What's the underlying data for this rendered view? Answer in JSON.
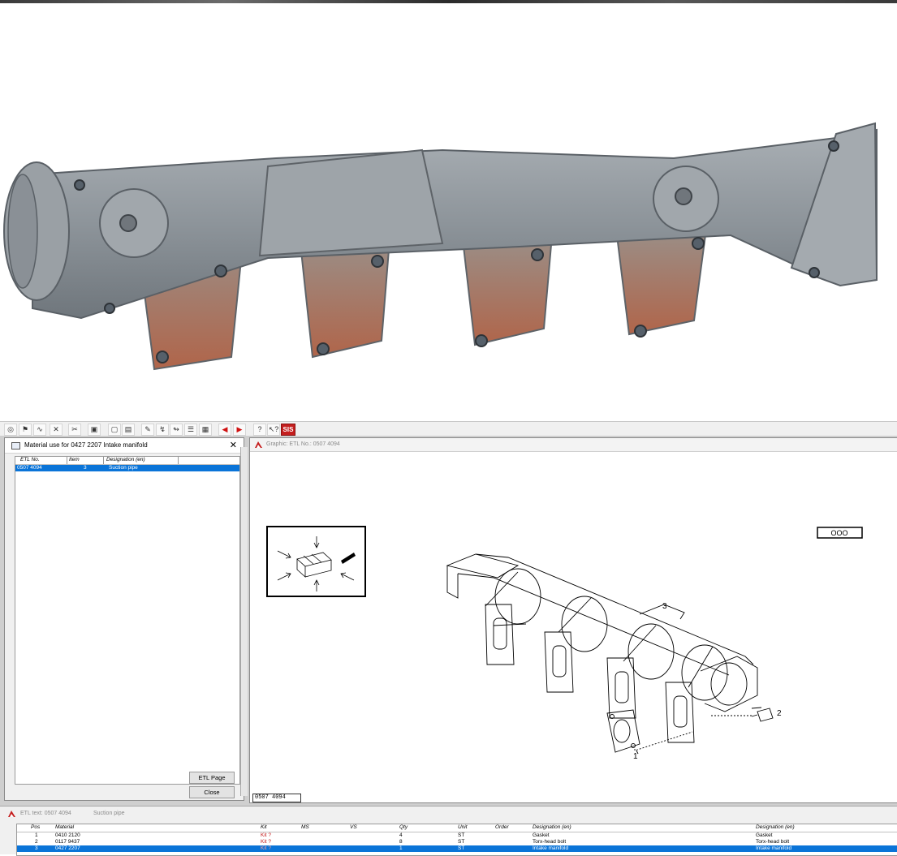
{
  "photo": {
    "subject_icon": "intake-manifold-photo"
  },
  "toolbar": {
    "buttons": [
      "glasses-icon",
      "bookmark-icon",
      "wrench-icon",
      "x-icon",
      "cut-icon",
      "print-icon",
      "new-doc-icon",
      "open-folder-icon",
      "pencil-icon",
      "ref-a-icon",
      "ref-b-icon",
      "list-icon",
      "grid-icon",
      "arrow-left-icon",
      "arrow-right-icon",
      "help-icon",
      "pointer-help-icon",
      "sis-logo"
    ],
    "sis_label": "SIS"
  },
  "material_dialog": {
    "title": "Material use for 0427 2207 Intake manifold",
    "close_symbol": "✕",
    "columns": [
      "ETL No.",
      "Item",
      "Designation (en)"
    ],
    "rows": [
      {
        "etl_no": "0507 4094",
        "item": "3",
        "designation": "Suction pipe"
      }
    ],
    "etl_page_button": "ETL Page",
    "close_button": "Close"
  },
  "graphic_window": {
    "title": "Graphic: ETL No.: 0507 4094",
    "etl_no_label": "0507 4094",
    "box_label": "OOO",
    "callouts": [
      "3",
      "2",
      "1"
    ]
  },
  "etl_text": {
    "title": "ETL text: 0507 4094",
    "description": "Suction pipe",
    "columns": [
      "Pos",
      "Material",
      "Kit",
      "MS",
      "VS",
      "Qty",
      "Unit",
      "Order",
      "Designation (en)",
      "Designation (en)"
    ],
    "rows": [
      {
        "pos": "1",
        "material": "0410 2120",
        "kit": "Kit ?",
        "qty": "4",
        "unit": "ST",
        "designation": "Gasket",
        "designation2": "Gasket",
        "selected": false
      },
      {
        "pos": "2",
        "material": "0117 9437",
        "kit": "Kit ?",
        "qty": "8",
        "unit": "ST",
        "designation": "Torx-head bolt",
        "designation2": "Torx-head bolt",
        "selected": false
      },
      {
        "pos": "3",
        "material": "0427 2207",
        "kit": "Kit ?",
        "qty": "1",
        "unit": "ST",
        "designation": "Intake manifold",
        "designation2": "Intake manifold",
        "selected": true
      }
    ]
  },
  "colors": {
    "selection": "#0a74d8",
    "kit_red": "#c21818",
    "sis_red": "#c41e1e",
    "manifold_gray": "#8e959b"
  }
}
